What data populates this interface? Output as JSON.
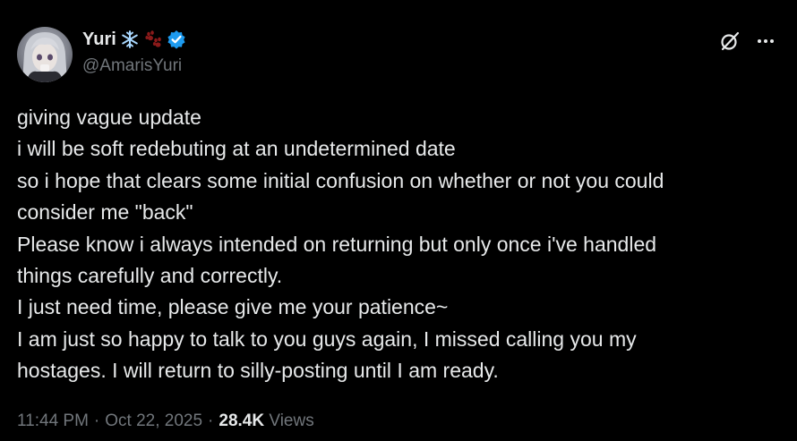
{
  "author": {
    "name": "Yuri",
    "handle": "@AmarisYuri",
    "verified": true,
    "name_emojis": [
      "snowflake-emoji",
      "paw-prints-emoji"
    ]
  },
  "tweet": {
    "lines": [
      "giving vague update",
      "i will be soft redebuting at an undetermined date",
      "so i hope that clears some initial confusion on whether or not you could",
      "consider me \"back\"",
      "Please know i always intended on returning but only once i've handled",
      "things carefully and correctly.",
      "I just need time, please give me your patience~",
      "I am just so happy to talk to you guys again, I missed calling you my",
      "hostages. I will return to silly-posting until I am ready."
    ]
  },
  "meta": {
    "time": "11:44 PM",
    "date": "Oct 22, 2025",
    "separator": "·",
    "views_count": "28.4K",
    "views_label": "Views"
  },
  "icons": [
    "grok-icon",
    "more-icon",
    "verified-badge-icon"
  ],
  "colors": {
    "background": "#000000",
    "text": "#e7e9ea",
    "secondary": "#71767b",
    "verified": "#1d9bf0",
    "paw": "#8b1a1a"
  }
}
